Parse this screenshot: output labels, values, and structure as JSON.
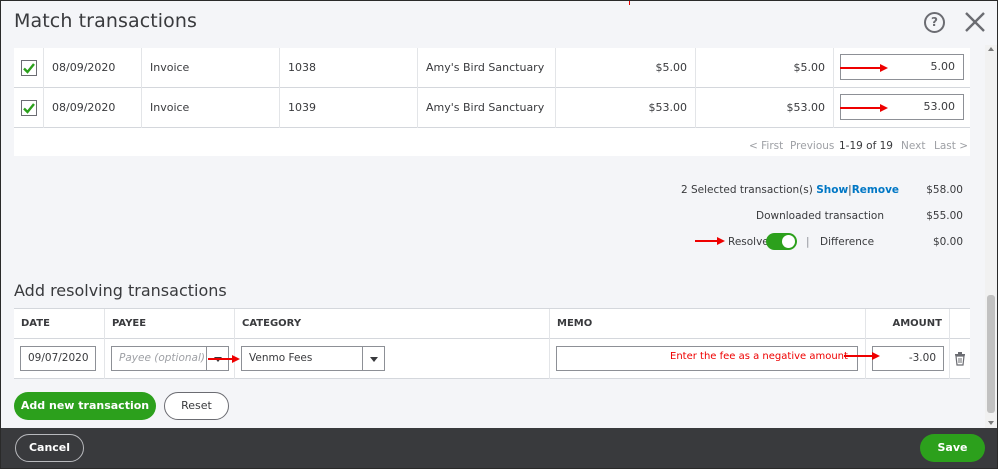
{
  "dialog": {
    "title": "Match transactions"
  },
  "matches": {
    "rows": [
      {
        "date": "08/09/2020",
        "type": "Invoice",
        "ref": "1038",
        "name": "Amy's Bird Sanctuary",
        "original": "$5.00",
        "open": "$5.00",
        "payment": "5.00",
        "checked": true
      },
      {
        "date": "08/09/2020",
        "type": "Invoice",
        "ref": "1039",
        "name": "Amy's Bird Sanctuary",
        "original": "$53.00",
        "open": "$53.00",
        "payment": "53.00",
        "checked": true
      }
    ],
    "pager": {
      "first": "< First",
      "previous": "Previous",
      "count": "1-19 of 19",
      "next": "Next",
      "last": "Last >"
    }
  },
  "summary": {
    "selected_label": "2 Selected transaction(s)",
    "show": "Show",
    "separator": "|",
    "remove": "Remove",
    "selected_amount": "$58.00",
    "downloaded_label": "Downloaded transaction",
    "downloaded_amount": "$55.00",
    "resolve_label": "Resolve",
    "resolve_on": true,
    "diff_separator": "|",
    "difference_label": "Difference",
    "difference_amount": "$0.00"
  },
  "resolving": {
    "title": "Add resolving transactions",
    "columns": {
      "date": "DATE",
      "payee": "PAYEE",
      "category": "CATEGORY",
      "memo": "MEMO",
      "amount": "AMOUNT"
    },
    "row": {
      "date": "09/07/2020",
      "payee_placeholder": "Payee (optional)",
      "category": "Venmo Fees",
      "memo": "",
      "amount": "-3.00"
    },
    "note": "Enter the fee as a negative amount",
    "add_button": "Add new transaction",
    "reset_button": "Reset"
  },
  "footer": {
    "cancel": "Cancel",
    "save": "Save"
  },
  "colors": {
    "accent_green": "#2ca01c",
    "link_blue": "#0077c5",
    "annotation_red": "#e00000",
    "footer_dark": "#393a3d"
  },
  "icons": [
    "help-icon",
    "close-icon",
    "checkbox-checked-icon",
    "dropdown-arrow-icon",
    "trash-icon",
    "red-arrow-annotation"
  ]
}
